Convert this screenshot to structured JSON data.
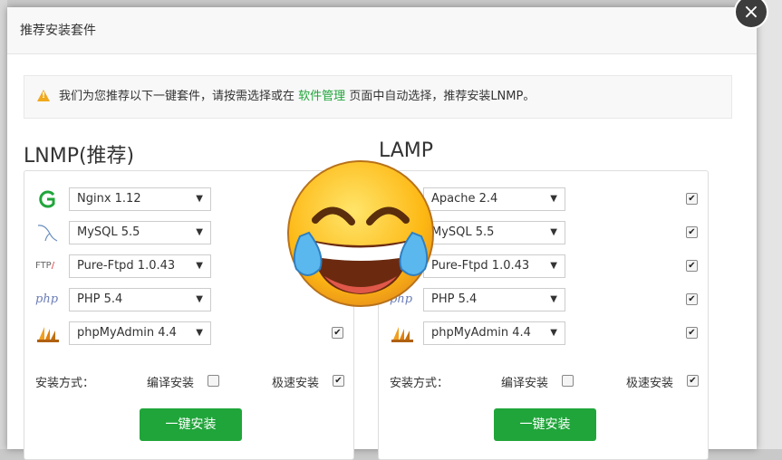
{
  "dialog": {
    "title": "推荐安装套件",
    "close_icon": "close-icon"
  },
  "notice": {
    "prefix": "我们为您推荐以下一键套件，请按需选择或在",
    "link_text": "软件管理",
    "suffix": "页面中自动选择，推荐安装LNMP。"
  },
  "lnmp": {
    "title": "LNMP(推荐)",
    "rows": [
      {
        "icon": "nginx-icon",
        "value": "Nginx 1.12",
        "checked": true
      },
      {
        "icon": "mysql-icon",
        "value": "MySQL 5.5",
        "checked": true
      },
      {
        "icon": "ftp-icon",
        "value": "Pure-Ftpd 1.0.43",
        "checked": true
      },
      {
        "icon": "php-icon",
        "value": "PHP 5.4",
        "checked": true
      },
      {
        "icon": "phpmyadmin-icon",
        "value": "phpMyAdmin 4.4",
        "checked": true
      }
    ],
    "method_label": "安装方式：",
    "compile_label": "编译安装",
    "fast_label": "极速安装",
    "install_button": "一键安装"
  },
  "lamp": {
    "title": "LAMP",
    "rows": [
      {
        "icon": "apache-icon",
        "value": "Apache 2.4",
        "checked": true
      },
      {
        "icon": "mysql-icon",
        "value": "MySQL 5.5",
        "checked": true
      },
      {
        "icon": "ftp-icon",
        "value": "Pure-Ftpd 1.0.43",
        "checked": true
      },
      {
        "icon": "php-icon",
        "value": "PHP 5.4",
        "checked": true
      },
      {
        "icon": "phpmyadmin-icon",
        "value": "phpMyAdmin 4.4",
        "checked": true
      }
    ],
    "method_label": "安装方式：",
    "compile_label": "编译安装",
    "fast_label": "极速安装",
    "install_button": "一键安装"
  },
  "icons": {
    "ftp_text": "FTP",
    "php_text": "php",
    "arrow": "▼",
    "check": "✔"
  },
  "colors": {
    "accent": "#20a53a",
    "warning": "#f0a81c"
  }
}
